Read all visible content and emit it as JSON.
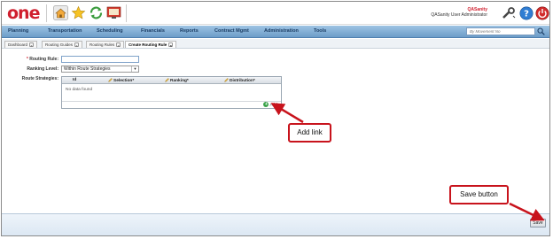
{
  "header": {
    "logo_text": "one",
    "user_name": "QASanity",
    "user_role": "QASanity User Administrator",
    "icons": [
      "home-icon",
      "star-icon",
      "refresh-icon",
      "monitor-icon",
      "wrench-icon",
      "help-icon",
      "power-icon"
    ]
  },
  "nav": {
    "items": [
      "Planning",
      "Transportation",
      "Scheduling",
      "Financials",
      "Reports",
      "Contract Mgmt",
      "Administration",
      "Tools"
    ],
    "search_placeholder": "By Movement No"
  },
  "tabs": [
    {
      "label": "Dashboard",
      "active": false
    },
    {
      "label": "Routing Guides",
      "active": false
    },
    {
      "label": "Routing Rules",
      "active": false
    },
    {
      "label": "Create Routing Rule",
      "active": true
    }
  ],
  "form": {
    "routing_rule_label": "Routing Rule:",
    "routing_rule_required": "*",
    "routing_rule_value": "",
    "ranking_level_label": "Ranking Level:",
    "ranking_level_value": "Within Route Strategies",
    "route_strategies_label": "Route Strategies:",
    "grid_columns": [
      "Id",
      "Selection*",
      "Ranking*",
      "Distribution*"
    ],
    "no_data": "No data found",
    "add_label": "Add"
  },
  "callouts": {
    "add_link": "Add link",
    "save_button": "Save button"
  },
  "footer": {
    "save_label": "Save"
  },
  "colors": {
    "brand_red": "#d01f2e",
    "nav_blue": "#6c9cc8",
    "callout_red": "#c8131c",
    "add_green": "#3aa34a"
  }
}
